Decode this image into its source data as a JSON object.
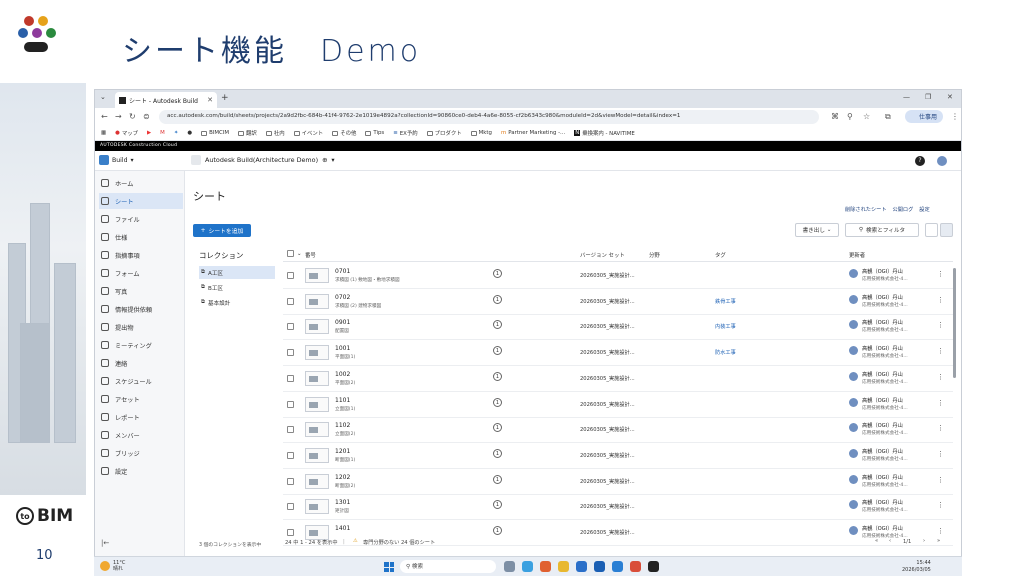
{
  "slide": {
    "title": "シート機能　Demo",
    "page_number": "10",
    "brand_logo": "BIM"
  },
  "browser": {
    "tab_title": "シート - Autodesk Build",
    "url": "acc.autodesk.com/build/sheets/projects/2a9d2fbc-684b-41f4-9762-2e1019e4892a?collectionId=90860ce0-deb4-4a6e-8055-cf2b6343c980&moduleId=2d&viewModel=detail&index=1",
    "profile_label": "仕事用",
    "bookmarks": [
      "マップ",
      "BIMCIM",
      "翻訳",
      "社内",
      "イベント",
      "その他",
      "Tips",
      "EX予約",
      "プロダクト",
      "Mktg",
      "Partner Marketing -...",
      "乗換案内 - NAVITIME"
    ]
  },
  "app": {
    "top_bar": "AUTODESK Construction Cloud",
    "module": "Build",
    "project": "Autodesk Build(Architecture Demo)",
    "help_label": "?",
    "sidebar": [
      {
        "label": "ホーム",
        "icon": "home-icon"
      },
      {
        "label": "シート",
        "icon": "sheet-icon",
        "active": true
      },
      {
        "label": "ファイル",
        "icon": "file-icon"
      },
      {
        "label": "仕様",
        "icon": "spec-icon"
      },
      {
        "label": "指摘事項",
        "icon": "issue-icon"
      },
      {
        "label": "フォーム",
        "icon": "form-icon"
      },
      {
        "label": "写真",
        "icon": "photo-icon"
      },
      {
        "label": "情報提供依頼",
        "icon": "rfi-icon"
      },
      {
        "label": "提出物",
        "icon": "submittal-icon"
      },
      {
        "label": "ミーティング",
        "icon": "meeting-icon"
      },
      {
        "label": "連絡",
        "icon": "mail-icon"
      },
      {
        "label": "スケジュール",
        "icon": "schedule-icon"
      },
      {
        "label": "アセット",
        "icon": "asset-icon"
      },
      {
        "label": "レポート",
        "icon": "report-icon"
      },
      {
        "label": "メンバー",
        "icon": "members-icon"
      },
      {
        "label": "ブリッジ",
        "icon": "bridge-icon"
      },
      {
        "label": "設定",
        "icon": "settings-icon"
      }
    ],
    "page_title": "シート",
    "header_links": [
      "削除されたシート",
      "公開ログ",
      "設定"
    ],
    "add_button": "シートを追加",
    "export_button": "書き出し",
    "search_filter_button": "検索とフィルタ",
    "collections_title": "コレクション",
    "collections": [
      {
        "label": "A工区",
        "active": true
      },
      {
        "label": "B工区"
      },
      {
        "label": "基本設計"
      }
    ],
    "collections_footer": "3 個のコレクションを表示中",
    "columns": {
      "number": "番号",
      "version_set": "バージョン セット",
      "discipline": "分野",
      "tag": "タグ",
      "updated_by": "更新者"
    },
    "rows": [
      {
        "number": "0701",
        "desc": "求積図 (1) 敷地図・敷地求積図",
        "version": "1",
        "set": "20260305_実施設計...",
        "tag": "",
        "updater": "高観（OGI）丹山",
        "org": "応用技術株式会社-4..."
      },
      {
        "number": "0702",
        "desc": "求積図 (2) 建物求積図",
        "version": "1",
        "set": "20260305_実施設計...",
        "tag": "鉄骨工事",
        "updater": "高観（OGI）丹山",
        "org": "応用技術株式会社-4..."
      },
      {
        "number": "0901",
        "desc": "配置図",
        "version": "1",
        "set": "20260305_実施設計...",
        "tag": "内装工事",
        "updater": "高観（OGI）丹山",
        "org": "応用技術株式会社-4..."
      },
      {
        "number": "1001",
        "desc": "平面図(1)",
        "version": "1",
        "set": "20260305_実施設計...",
        "tag": "防水工事",
        "updater": "高観（OGI）丹山",
        "org": "応用技術株式会社-4..."
      },
      {
        "number": "1002",
        "desc": "平面図(2)",
        "version": "1",
        "set": "20260305_実施設計...",
        "tag": "",
        "updater": "高観（OGI）丹山",
        "org": "応用技術株式会社-4..."
      },
      {
        "number": "1101",
        "desc": "立面図(1)",
        "version": "1",
        "set": "20260305_実施設計...",
        "tag": "",
        "updater": "高観（OGI）丹山",
        "org": "応用技術株式会社-4..."
      },
      {
        "number": "1102",
        "desc": "立面図(2)",
        "version": "1",
        "set": "20260305_実施設計...",
        "tag": "",
        "updater": "高観（OGI）丹山",
        "org": "応用技術株式会社-4..."
      },
      {
        "number": "1201",
        "desc": "断面図(1)",
        "version": "1",
        "set": "20260305_実施設計...",
        "tag": "",
        "updater": "高観（OGI）丹山",
        "org": "応用技術株式会社-4..."
      },
      {
        "number": "1202",
        "desc": "断面図(2)",
        "version": "1",
        "set": "20260305_実施設計...",
        "tag": "",
        "updater": "高観（OGI）丹山",
        "org": "応用技術株式会社-4..."
      },
      {
        "number": "1301",
        "desc": "矩計図",
        "version": "1",
        "set": "20260305_実施設計...",
        "tag": "",
        "updater": "高観（OGI）丹山",
        "org": "応用技術株式会社-4..."
      },
      {
        "number": "1401",
        "desc": "",
        "version": "1",
        "set": "20260305_実施設計...",
        "tag": "",
        "updater": "高観（OGI）丹山",
        "org": "応用技術株式会社-4..."
      }
    ],
    "footer_count": "24 中 1 - 24 を表示中",
    "footer_warning": "専門分野のない 24 個のシート",
    "pagination": "1/1"
  },
  "taskbar": {
    "weather_temp": "11°C",
    "weather_desc": "晴れ",
    "search": "検索",
    "time": "15:44",
    "date": "2026/03/05"
  },
  "colors": {
    "accent": "#1f73c9",
    "title": "#1f3d6e",
    "tag": "#1a5fb4"
  }
}
